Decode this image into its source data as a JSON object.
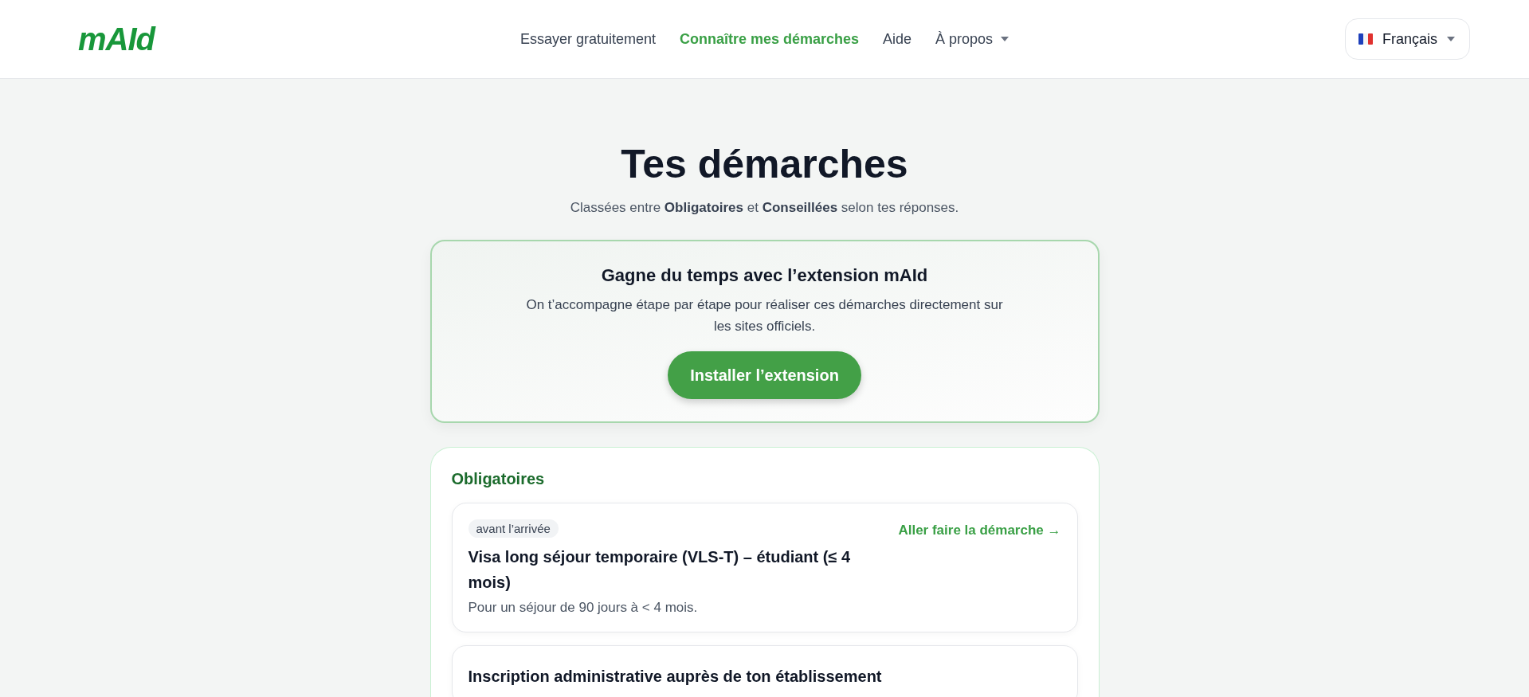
{
  "logo": "mAId",
  "nav": [
    {
      "label": "Essayer gratuitement",
      "selected": false,
      "dropdown": false
    },
    {
      "label": "Connaître mes démarches",
      "selected": true,
      "dropdown": false
    },
    {
      "label": "Aide",
      "selected": false,
      "dropdown": false
    },
    {
      "label": "À propos",
      "selected": false,
      "dropdown": true
    }
  ],
  "language": {
    "label": "Français"
  },
  "heading": "Tes démarches",
  "subtitle": "Classées entre **Obligatoires** et **Conseillées** selon tes réponses.",
  "promo": {
    "title": "Gagne du temps avec l’extension mAId",
    "text": "On t’accompagne étape par étape pour réaliser ces démarches directement sur les sites officiels.",
    "button": "Installer l’extension"
  },
  "section": {
    "title": "Obligatoires",
    "items": [
      {
        "tag": "avant l’arrivée",
        "title": "Visa long séjour temporaire (VLS-T) – étudiant (≤ 4 mois)",
        "description": "Pour un séjour de 90 jours à < 4 mois.",
        "link": "Aller faire la démarche →"
      },
      {
        "title": "Inscription administrative auprès de ton établissement"
      }
    ]
  }
}
